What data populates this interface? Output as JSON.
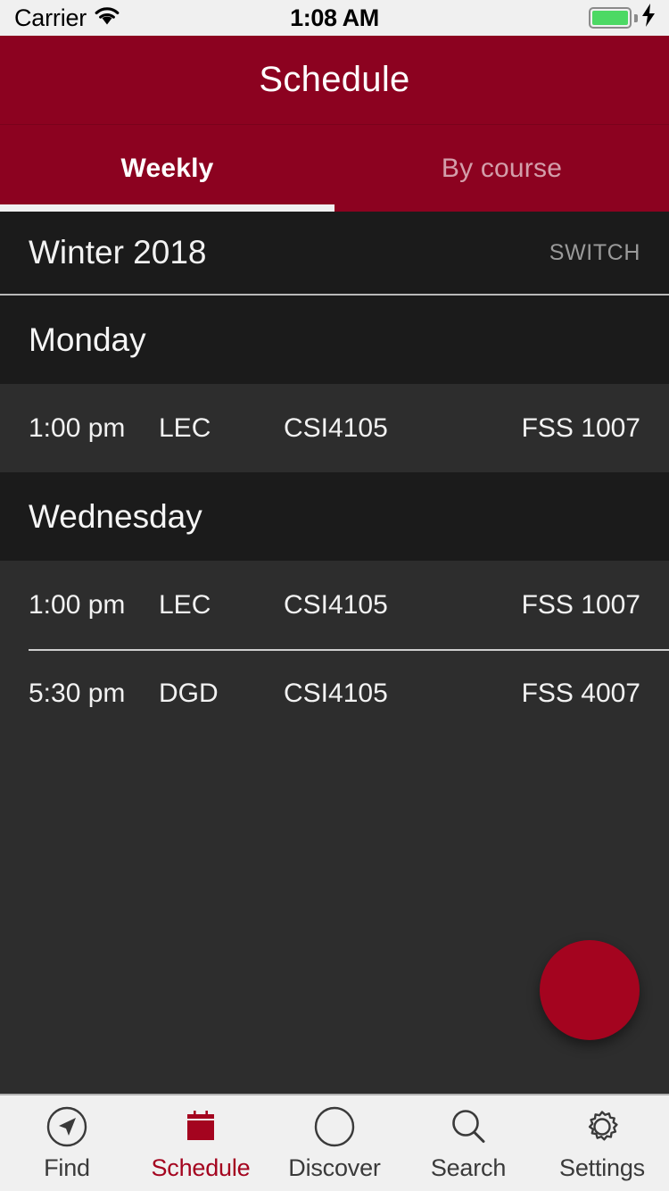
{
  "status_bar": {
    "carrier": "Carrier",
    "wifi_icon": "wifi-icon",
    "time": "1:08 AM",
    "battery_icon": "battery-full-icon",
    "charging_icon": "charging-bolt-icon"
  },
  "header": {
    "title": "Schedule",
    "brand_color": "#8c0220"
  },
  "tabs": [
    {
      "label": "Weekly",
      "active": true
    },
    {
      "label": "By course",
      "active": false
    }
  ],
  "term": {
    "name": "Winter 2018",
    "switch_label": "SWITCH"
  },
  "schedule": [
    {
      "day": "Monday",
      "classes": [
        {
          "time": "1:00 pm",
          "type": "LEC",
          "code": "CSI4105",
          "room": "FSS 1007"
        }
      ]
    },
    {
      "day": "Wednesday",
      "classes": [
        {
          "time": "1:00 pm",
          "type": "LEC",
          "code": "CSI4105",
          "room": "FSS 1007"
        },
        {
          "time": "5:30 pm",
          "type": "DGD",
          "code": "CSI4105",
          "room": "FSS 4007"
        }
      ]
    }
  ],
  "fab": {
    "icon": "plus-icon",
    "color": "#a4041f"
  },
  "tabbar": [
    {
      "label": "Find",
      "icon": "navigation-arrow-icon",
      "active": false
    },
    {
      "label": "Schedule",
      "icon": "calendar-icon",
      "active": true
    },
    {
      "label": "Discover",
      "icon": "compass-icon",
      "active": false
    },
    {
      "label": "Search",
      "icon": "magnifier-icon",
      "active": false
    },
    {
      "label": "Settings",
      "icon": "gear-icon",
      "active": false
    }
  ]
}
